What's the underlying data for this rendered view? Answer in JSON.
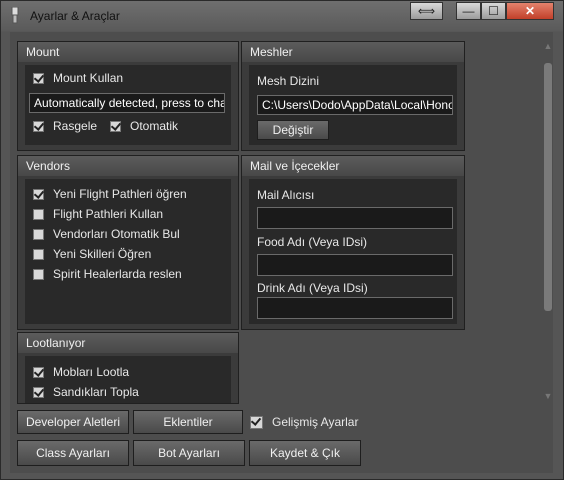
{
  "window": {
    "title": "Ayarlar & Araçlar",
    "controls": [
      "⟺",
      "—",
      "☐",
      "✕"
    ]
  },
  "mount": {
    "title": "Mount",
    "use_mount_label": "Mount Kullan",
    "use_mount_checked": true,
    "mount_field_value": "Automatically detected, press to change",
    "random_label": "Rasgele",
    "random_checked": true,
    "auto_label": "Otomatik",
    "auto_checked": true
  },
  "meshes": {
    "title": "Meshler",
    "dir_label": "Mesh Dizini",
    "dir_value": "C:\\Users\\Dodo\\AppData\\Local\\Honorbuddy",
    "change_button": "Değiştir"
  },
  "vendors": {
    "title": "Vendors",
    "items": [
      {
        "label": "Yeni Flight Pathleri öğren",
        "checked": true
      },
      {
        "label": "Flight Pathleri Kullan",
        "checked": false
      },
      {
        "label": "Vendorları Otomatik Bul",
        "checked": false
      },
      {
        "label": "Yeni Skilleri Öğren",
        "checked": false
      },
      {
        "label": "Spirit Healerlarda reslen",
        "checked": false
      }
    ]
  },
  "mail": {
    "title": "Mail ve İçecekler",
    "recipient_label": "Mail Alıcısı",
    "recipient_value": "",
    "food_label": "Food Adı (Veya IDsi)",
    "food_value": "",
    "drink_label": "Drink Adı (Veya IDsi)",
    "drink_value": ""
  },
  "loot": {
    "title": "Lootlanıyor",
    "items": [
      {
        "label": "Mobları Lootla",
        "checked": true
      },
      {
        "label": "Sandıkları Topla",
        "checked": true
      }
    ]
  },
  "buttons": {
    "developer": "Developer Aletleri",
    "plugins": "Eklentiler",
    "advanced_label": "Gelişmiş Ayarlar",
    "advanced_checked": true,
    "class_settings": "Class Ayarları",
    "bot_settings": "Bot Ayarları",
    "save_exit": "Kaydet & Çık"
  }
}
